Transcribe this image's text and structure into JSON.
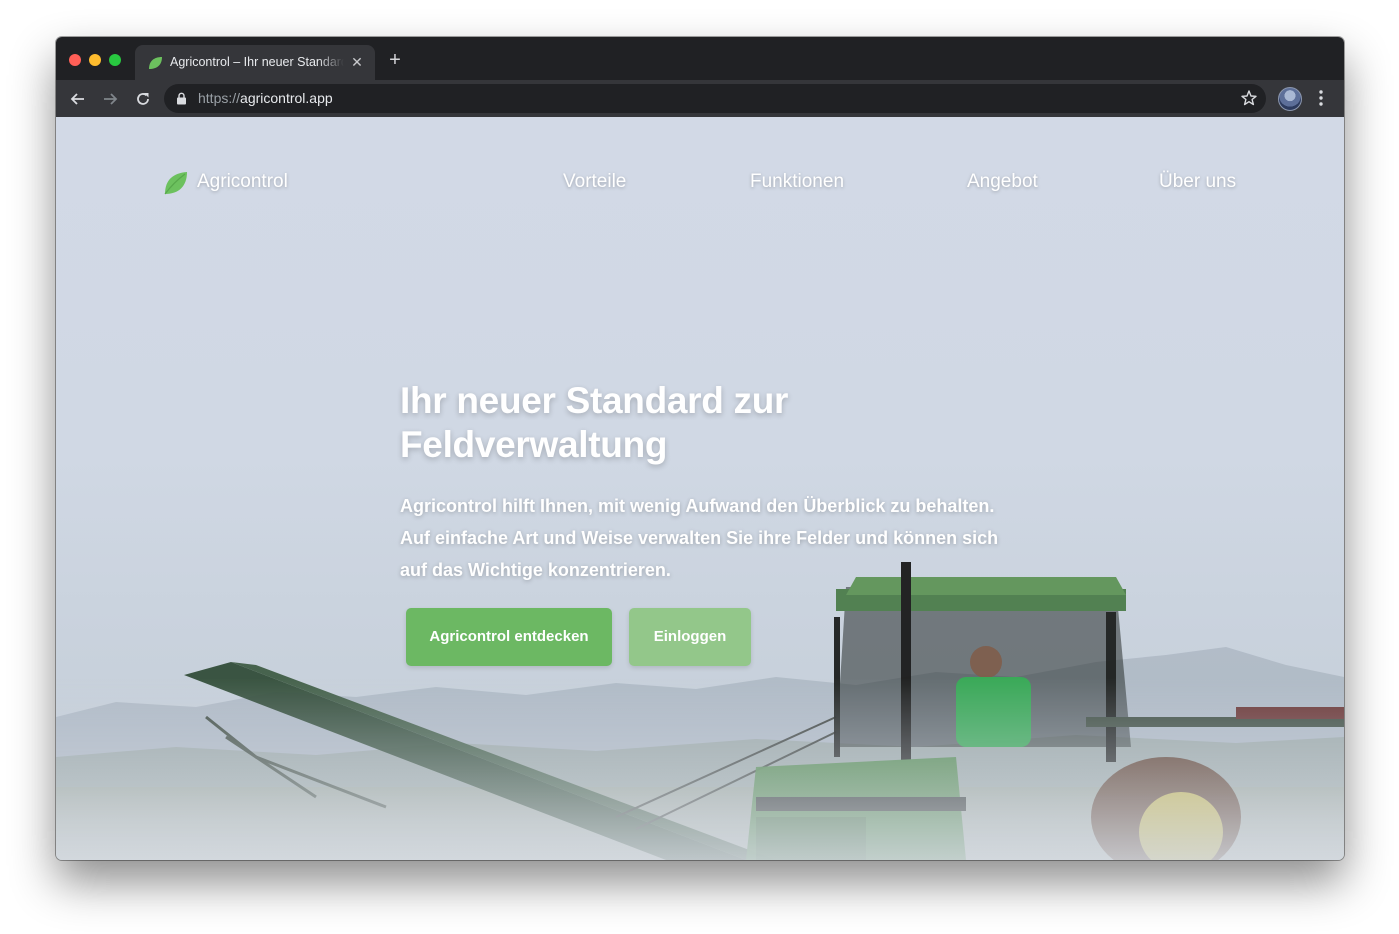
{
  "browser": {
    "tab_title": "Agricontrol – Ihr neuer Standard zur Feldverwaltung",
    "new_tab_symbol": "+",
    "close_symbol": "✕",
    "url_scheme": "https://",
    "url_host": "agricontrol.app"
  },
  "icons": {
    "back": "arrow-left-icon",
    "forward": "arrow-right-icon",
    "reload": "reload-icon",
    "lock": "lock-icon",
    "star": "star-icon",
    "menu": "kebab-menu-icon",
    "logo": "leaf-icon"
  },
  "nav": {
    "brand": "Agricontrol",
    "links": [
      "Vorteile",
      "Funktionen",
      "Angebot",
      "Über uns"
    ]
  },
  "hero": {
    "title_line1": "Ihr neuer Standard zur",
    "title_line2": "Feldverwaltung",
    "text_line1": "Agricontrol hilft Ihnen, mit wenig Aufwand den Überblick zu behalten.",
    "text_line2": "Auf einfache Art und Weise verwalten Sie ihre Felder und können sich",
    "text_line3": "auf das Wichtige konzentrieren.",
    "primary_button": "Agricontrol entdecken",
    "secondary_button": "Einloggen"
  },
  "colors": {
    "brand_green": "#6cb863",
    "brand_green_light": "#93c78a",
    "chrome_dark": "#202124",
    "chrome_toolbar": "#35363a"
  }
}
